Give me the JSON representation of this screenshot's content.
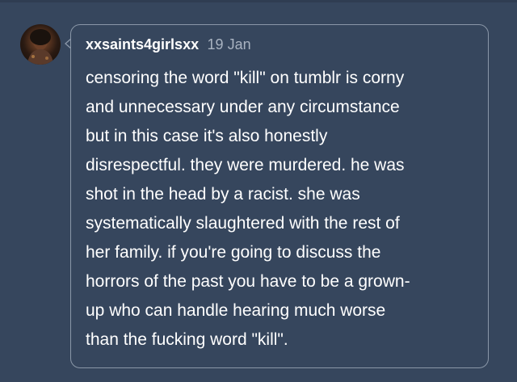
{
  "post": {
    "username": "xxsaints4girlsxx",
    "date": "19 Jan",
    "lines": [
      "censoring the word \"kill\" on tumblr is corny",
      "and unnecessary under any circumstance",
      "but in this case it's also honestly",
      "disrespectful. they were murdered. he was",
      "shot in the head by a racist. she was",
      "systematically slaughtered with the rest of",
      "her family. if you're going to discuss the",
      "horrors of the past you have to be a grown-",
      "up who can handle hearing much worse",
      "than the fucking word \"kill\"."
    ]
  },
  "colors": {
    "background": "#36465d",
    "border": "#8a97a8",
    "text": "#ffffff",
    "date": "#a9b3c1"
  }
}
